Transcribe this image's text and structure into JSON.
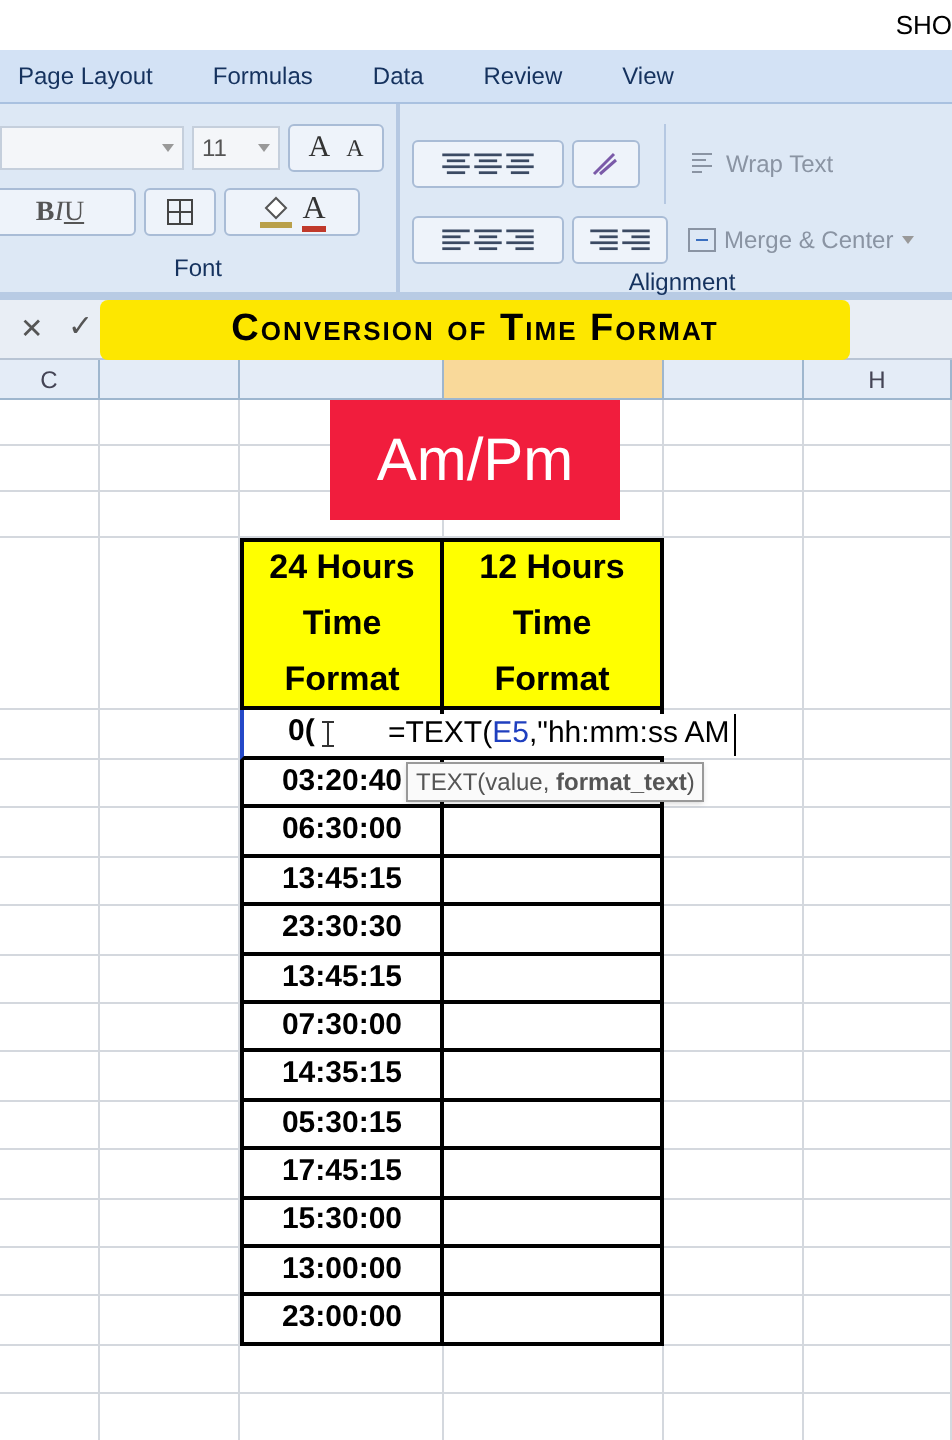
{
  "corner_text": "SHO",
  "tabs": [
    {
      "label": "Page Layout",
      "selected": false
    },
    {
      "label": "Formulas",
      "selected": false
    },
    {
      "label": "Data",
      "selected": false
    },
    {
      "label": "Review",
      "selected": false
    },
    {
      "label": "View",
      "selected": false
    }
  ],
  "font_group": {
    "label": "Font",
    "size": "11",
    "grow": "A",
    "shrink": "A",
    "bold": "B",
    "italic": "I",
    "underline": "U",
    "font_color": "A"
  },
  "alignment_group": {
    "label": "Alignment",
    "wrap_text": "Wrap Text",
    "merge_center": "Merge & Center"
  },
  "formula_bar": {
    "cancel": "✕",
    "enter": "✓"
  },
  "banner": "Conversion of Time Format",
  "badge": "Am/Pm",
  "columns": [
    {
      "label": "C",
      "selected": false
    },
    {
      "selected": false
    },
    {
      "selected": false
    },
    {
      "selected": true
    },
    {
      "selected": false
    },
    {
      "label": "H",
      "selected": false
    }
  ],
  "table": {
    "headers": [
      "24  Hours Time Format",
      "12 Hours Time Format"
    ],
    "editing": {
      "value": "0(",
      "formula_prefix": "=TEXT(",
      "formula_ref": "E5",
      "formula_suffix": ",\"hh:mm:ss AM"
    },
    "tooltip": "TEXT(value, **format_text**)",
    "rows": [
      "03:20:40",
      "06:30:00",
      "13:45:15",
      "23:30:30",
      "13:45:15",
      "07:30:00",
      "14:35:15",
      "05:30:15",
      "17:45:15",
      "15:30:00",
      "13:00:00",
      "23:00:00"
    ]
  }
}
